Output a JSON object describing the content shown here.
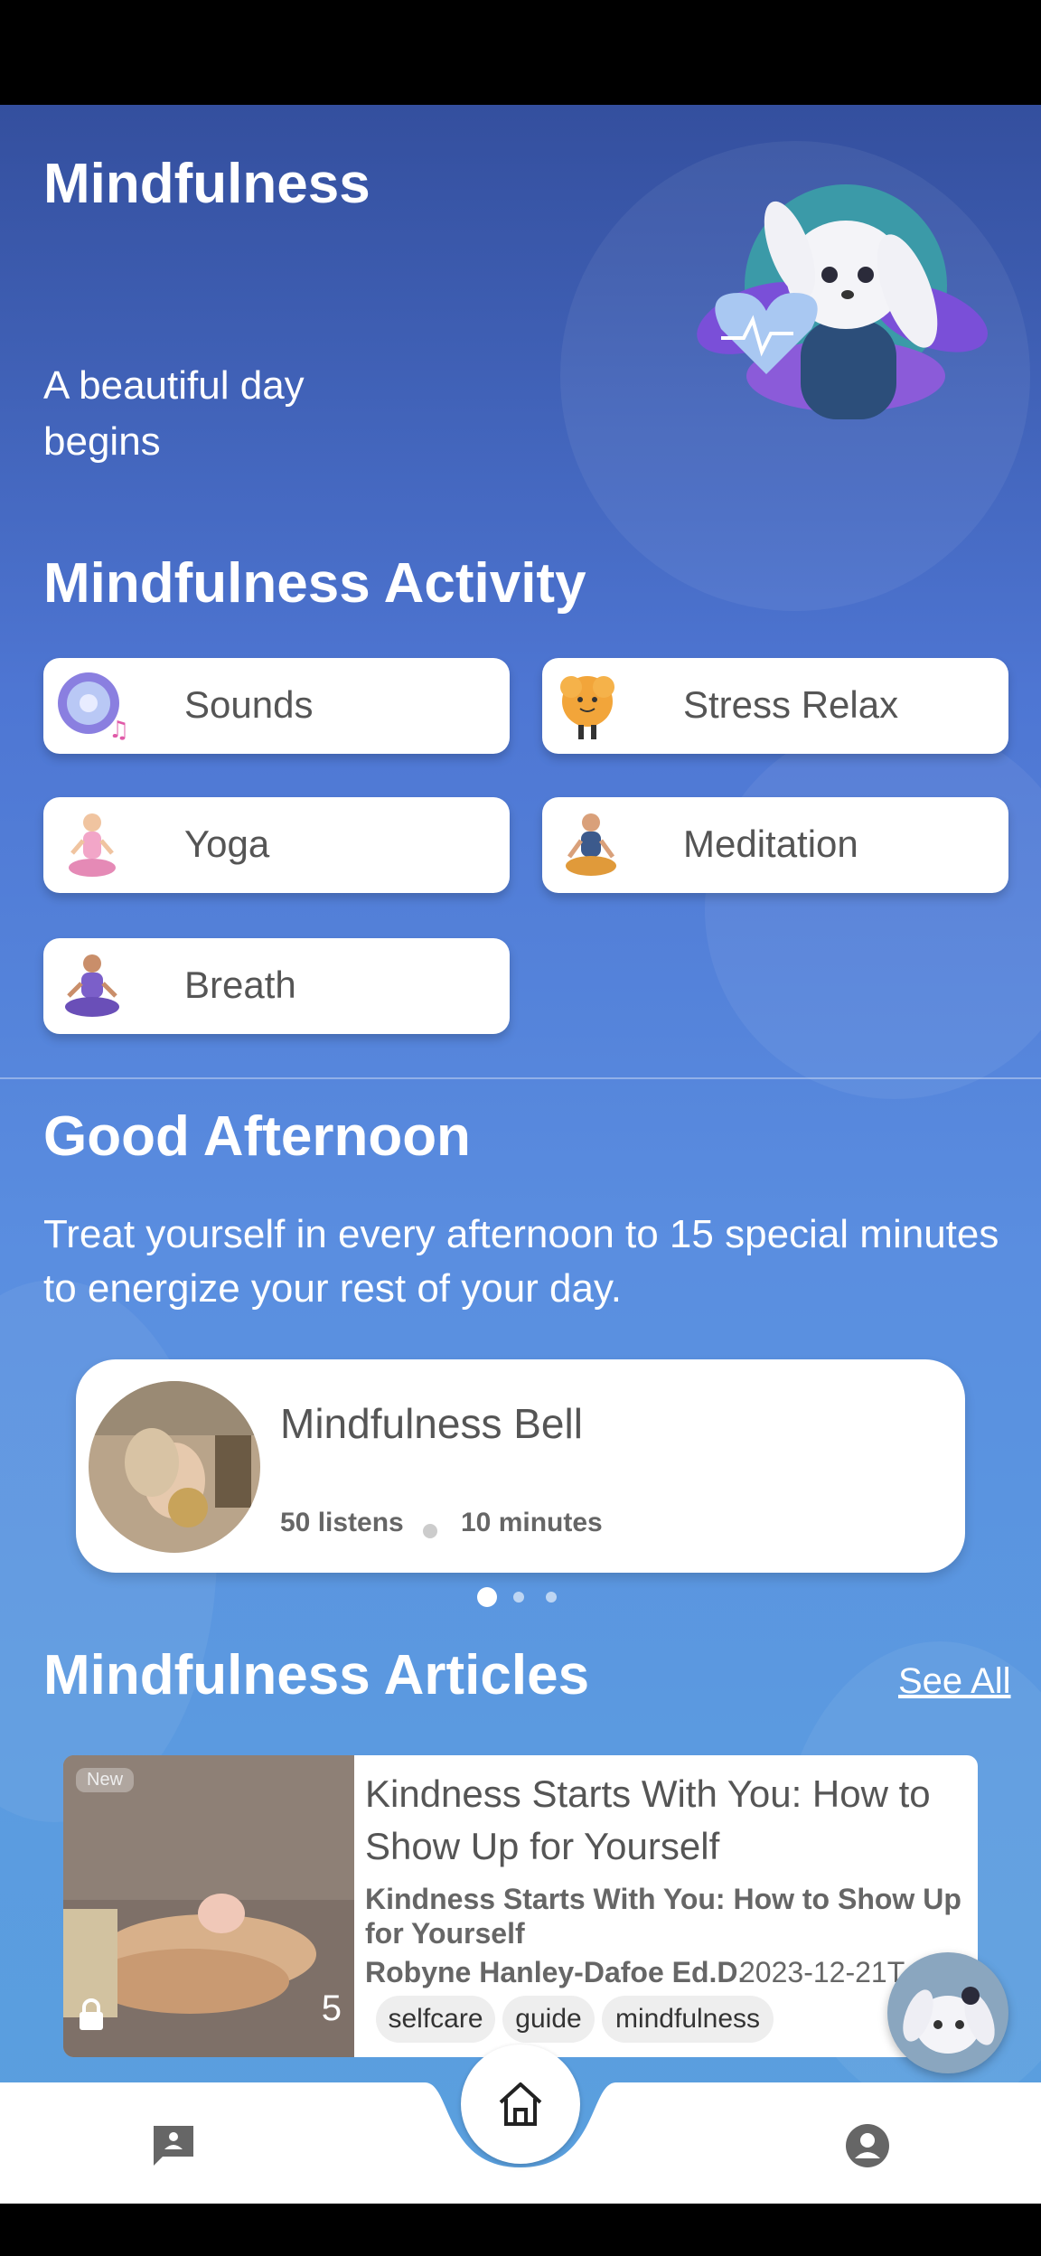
{
  "header": {
    "title": "Mindfulness",
    "subtitle": "A beautiful day begins"
  },
  "activity": {
    "title": "Mindfulness Activity",
    "items": [
      {
        "label": "Sounds",
        "icon": "sound-disc-icon"
      },
      {
        "label": "Stress Relax",
        "icon": "stress-ball-icon"
      },
      {
        "label": "Yoga",
        "icon": "yoga-figure-icon"
      },
      {
        "label": "Meditation",
        "icon": "meditation-figure-icon"
      },
      {
        "label": "Breath",
        "icon": "breath-figure-icon"
      }
    ]
  },
  "greeting": {
    "title": "Good Afternoon",
    "text": "Treat yourself in every afternoon to 15 special minutes to energize your rest of your day."
  },
  "session": {
    "title": "Mindfulness Bell",
    "listens": "50 listens",
    "duration": "10 minutes"
  },
  "pager": {
    "count": 3,
    "active": 0
  },
  "articles": {
    "title": "Mindfulness Articles",
    "see_all": "See All",
    "items": [
      {
        "badge": "New",
        "count": "5",
        "title": "Kindness Starts With You: How to Show Up for Yourself",
        "description": "Kindness Starts With You: How to Show Up for Yourself",
        "author": "Robyne Hanley-Dafoe Ed.D.",
        "date": "2023-12-21T",
        "tags": [
          "selfcare",
          "guide",
          "mindfulness"
        ]
      }
    ]
  },
  "nav": {
    "items": [
      "chat-icon",
      "home-icon",
      "profile-icon"
    ]
  },
  "colors": {
    "gradient_top": "#344f9e",
    "gradient_bottom": "#5aa0de",
    "card": "#ffffff",
    "text_muted": "#555555"
  }
}
